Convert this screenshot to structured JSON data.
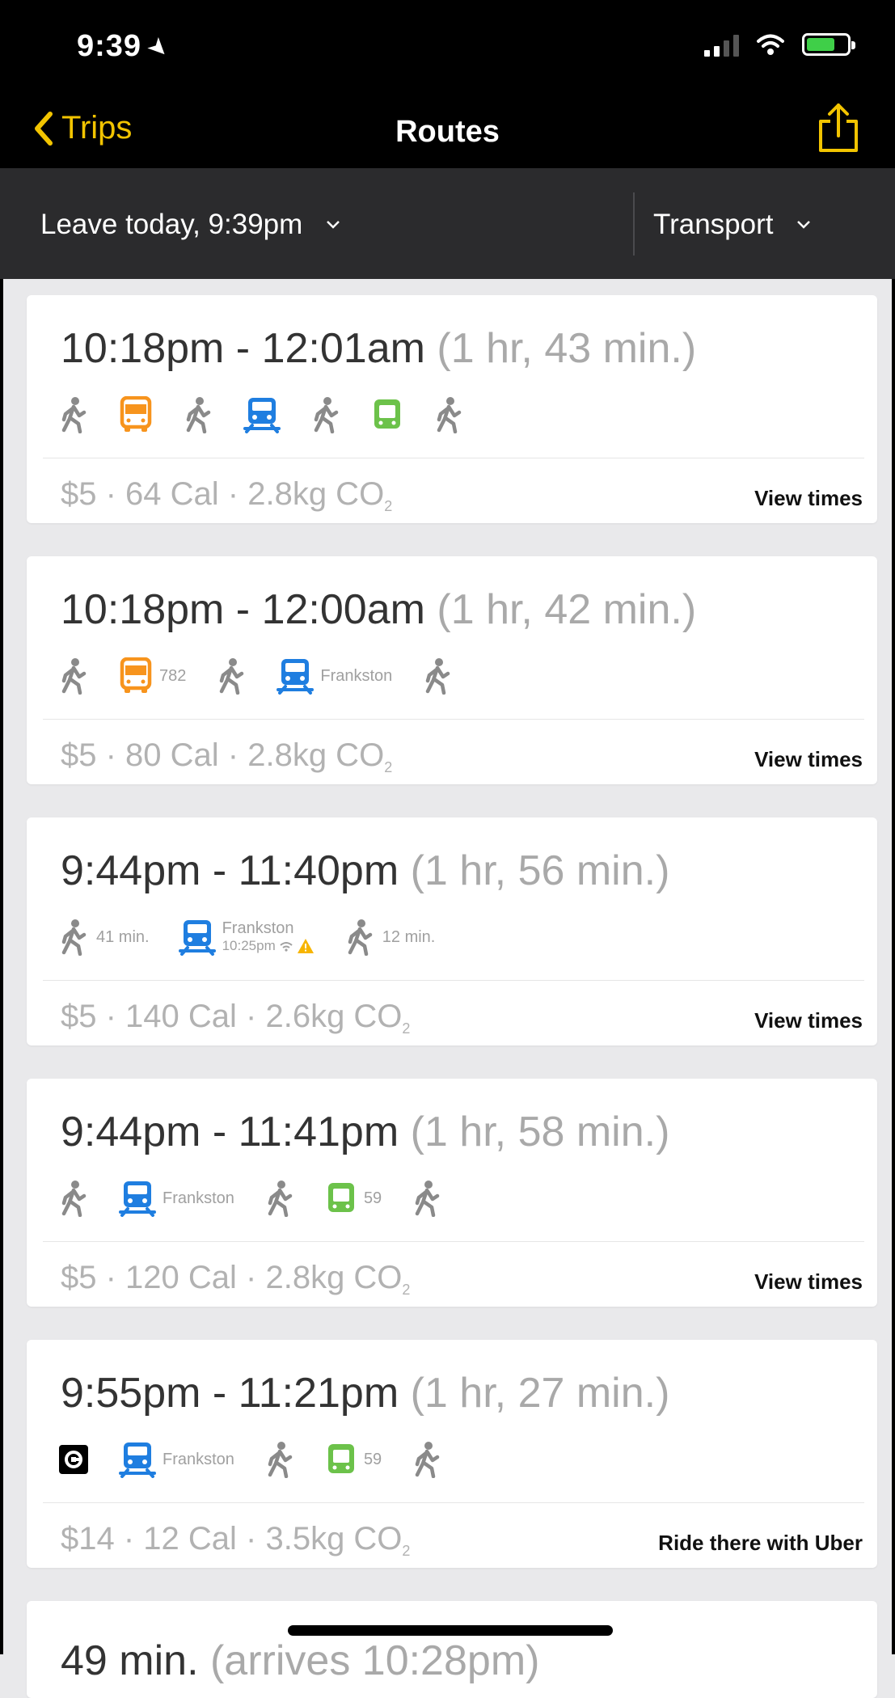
{
  "status": {
    "time": "9:39",
    "location_icon": "location-arrow-icon",
    "signal_icon": "cellular-signal-icon",
    "wifi_icon": "wifi-icon",
    "battery_icon": "battery-charging-icon"
  },
  "nav": {
    "back_label": "Trips",
    "title": "Routes",
    "share_icon": "share-icon"
  },
  "filters": {
    "leave_label": "Leave today, 9:39pm",
    "mode_label": "Transport"
  },
  "colors": {
    "accent": "#f2c400",
    "bus": "#f7941d",
    "train": "#1f7ee0",
    "tram": "#6cc24a",
    "walk": "#8a8a8a"
  },
  "routes": [
    {
      "time": "10:18pm - 12:01am",
      "duration": " (1 hr, 43 min.)",
      "stats": "$5 · 64 Cal · 2.8kg CO",
      "co2_sub": "2",
      "action": "View times",
      "legs": [
        {
          "mode": "walk"
        },
        {
          "mode": "bus"
        },
        {
          "mode": "walk"
        },
        {
          "mode": "train"
        },
        {
          "mode": "walk"
        },
        {
          "mode": "tram"
        },
        {
          "mode": "walk"
        }
      ]
    },
    {
      "time": "10:18pm - 12:00am",
      "duration": " (1 hr, 42 min.)",
      "stats": "$5 · 80 Cal · 2.8kg CO",
      "co2_sub": "2",
      "action": "View times",
      "legs": [
        {
          "mode": "walk"
        },
        {
          "mode": "bus",
          "label": "782"
        },
        {
          "mode": "walk"
        },
        {
          "mode": "train",
          "label": "Frankston"
        },
        {
          "mode": "walk"
        }
      ]
    },
    {
      "time": "9:44pm - 11:40pm",
      "duration": " (1 hr, 56 min.)",
      "stats": "$5 · 140 Cal · 2.6kg CO",
      "co2_sub": "2",
      "action": "View times",
      "legs": [
        {
          "mode": "walk",
          "label": "41 min."
        },
        {
          "mode": "train",
          "label": "Frankston",
          "sublabel": "10:25pm"
        },
        {
          "mode": "walk",
          "label": "12 min."
        }
      ]
    },
    {
      "time": "9:44pm - 11:41pm",
      "duration": " (1 hr, 58 min.)",
      "stats": "$5 · 120 Cal · 2.8kg CO",
      "co2_sub": "2",
      "action": "View times",
      "legs": [
        {
          "mode": "walk"
        },
        {
          "mode": "train",
          "label": "Frankston"
        },
        {
          "mode": "walk"
        },
        {
          "mode": "tram",
          "label": "59"
        },
        {
          "mode": "walk"
        }
      ]
    },
    {
      "time": "9:55pm - 11:21pm",
      "duration": " (1 hr, 27 min.)",
      "stats": "$14 · 12 Cal · 3.5kg CO",
      "co2_sub": "2",
      "action": "Ride there with Uber",
      "legs": [
        {
          "mode": "uber"
        },
        {
          "mode": "train",
          "label": "Frankston"
        },
        {
          "mode": "walk"
        },
        {
          "mode": "tram",
          "label": "59"
        },
        {
          "mode": "walk"
        }
      ]
    }
  ],
  "partial_route": {
    "time": "49 min.",
    "duration": " (arrives 10:28pm)"
  }
}
